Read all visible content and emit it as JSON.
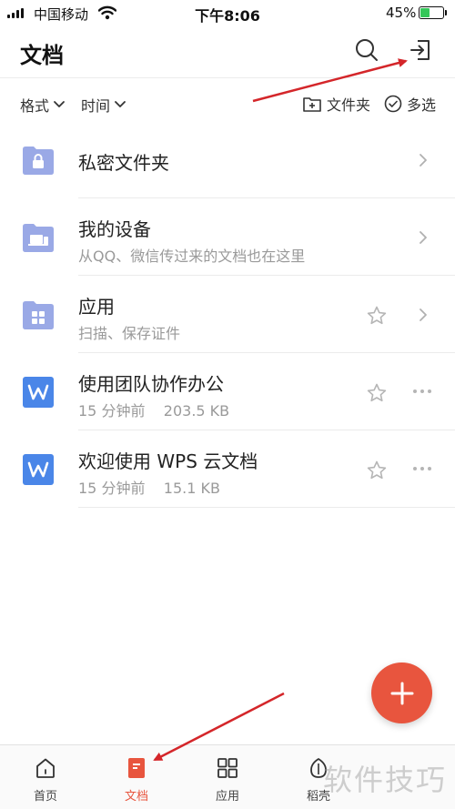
{
  "status_bar": {
    "carrier": "中国移动",
    "time": "下午8:06",
    "battery_percent": "45%",
    "battery_level": 0.45
  },
  "header": {
    "title": "文档",
    "search_icon": "search-icon",
    "exit_icon": "sign-in-icon"
  },
  "toolbar": {
    "format_label": "格式",
    "time_label": "时间",
    "new_folder_label": "文件夹",
    "multi_select_label": "多选"
  },
  "list": [
    {
      "name": "私密文件夹",
      "subtitle": "",
      "icon": "lock-folder-icon"
    },
    {
      "name": "我的设备",
      "subtitle": "从QQ、微信传过来的文档也在这里",
      "icon": "device-folder-icon"
    },
    {
      "name": "应用",
      "subtitle": "扫描、保存证件",
      "icon": "apps-folder-icon"
    },
    {
      "name": "使用团队协作办公",
      "subtitle": "15 分钟前    203.5 KB",
      "icon": "wps-word-icon"
    },
    {
      "name": "欢迎使用 WPS 云文档",
      "subtitle": "15 分钟前    15.1 KB",
      "icon": "wps-word-icon"
    }
  ],
  "tabs": [
    {
      "label": "首页",
      "icon": "home-icon"
    },
    {
      "label": "文档",
      "icon": "document-icon"
    },
    {
      "label": "应用",
      "icon": "grid-icon"
    },
    {
      "label": "稻壳",
      "icon": "daoke-icon"
    }
  ],
  "watermark": "软件技巧",
  "colors": {
    "accent": "#e8553e",
    "folder": "#9aa9e6",
    "word_icon": "#4a86e8",
    "arrow": "#d4262a"
  }
}
